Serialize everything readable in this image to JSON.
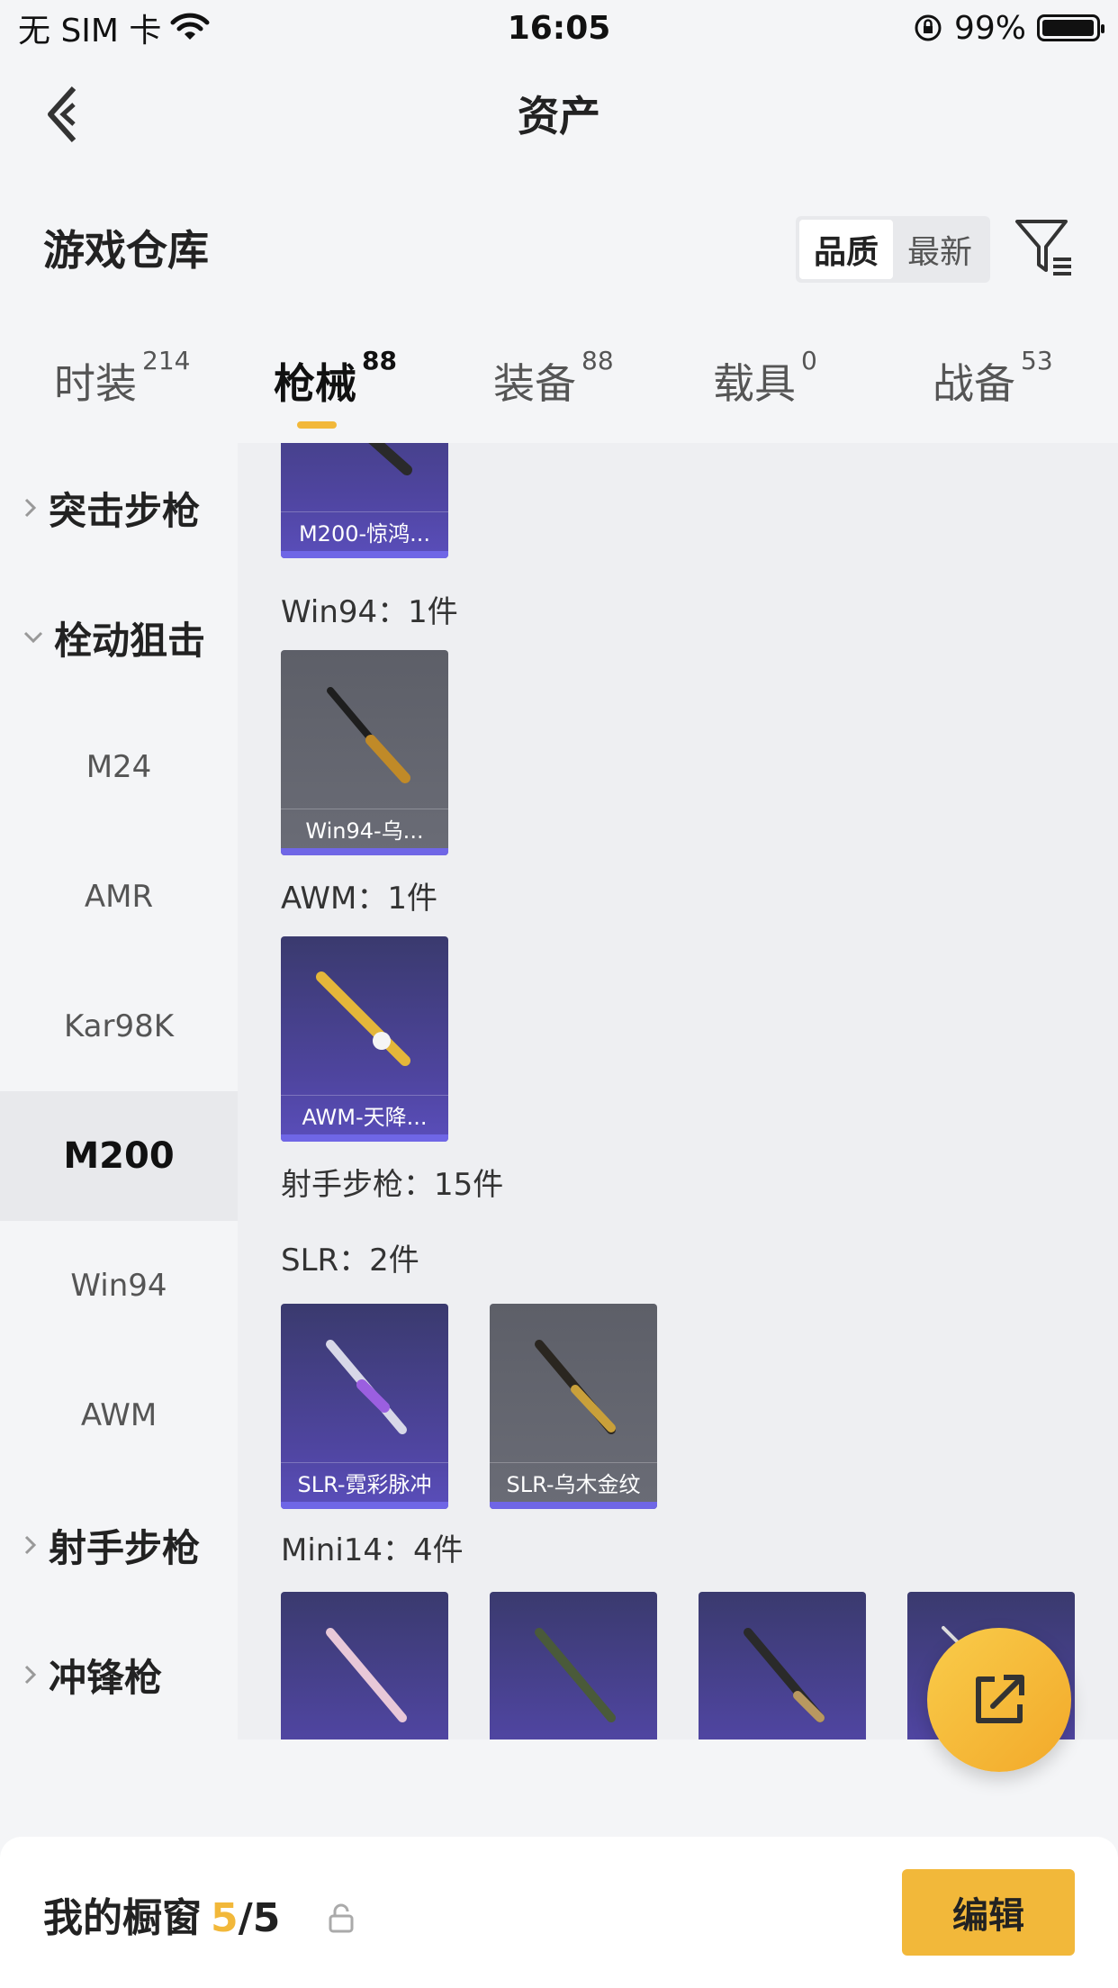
{
  "status_bar": {
    "carrier": "无 SIM 卡",
    "time": "16:05",
    "battery": "99%",
    "battery_level": 0.99
  },
  "header": {
    "title": "资产",
    "back_icon": "chevron-left-icon"
  },
  "warehouse": {
    "title": "游戏仓库",
    "sort_options": [
      "品质",
      "最新"
    ],
    "selected_sort": "品质",
    "filter_icon": "filter-icon"
  },
  "tabs": [
    {
      "label": "时装",
      "count": "214",
      "active": false
    },
    {
      "label": "枪械",
      "count": "88",
      "active": true
    },
    {
      "label": "装备",
      "count": "88",
      "active": false
    },
    {
      "label": "载具",
      "count": "0",
      "active": false
    },
    {
      "label": "战备",
      "count": "53",
      "active": false
    }
  ],
  "sidebar": {
    "items": [
      {
        "label": "突击步枪",
        "type": "group",
        "expanded": false
      },
      {
        "label": "栓动狙击",
        "type": "group",
        "expanded": true
      },
      {
        "label": "M24",
        "type": "sub"
      },
      {
        "label": "AMR",
        "type": "sub"
      },
      {
        "label": "Kar98K",
        "type": "sub"
      },
      {
        "label": "M200",
        "type": "sub",
        "selected": true
      },
      {
        "label": "Win94",
        "type": "sub"
      },
      {
        "label": "AWM",
        "type": "sub"
      },
      {
        "label": "射手步枪",
        "type": "group",
        "expanded": false
      },
      {
        "label": "冲锋枪",
        "type": "group",
        "expanded": false
      }
    ]
  },
  "content": {
    "groups": [
      {
        "label": "",
        "cards": [
          {
            "name": "M200-惊鸿...",
            "style": "purple"
          }
        ]
      },
      {
        "label": "Win94：1件",
        "cards": [
          {
            "name": "Win94-乌...",
            "style": "gray"
          }
        ]
      },
      {
        "label": "AWM：1件",
        "cards": [
          {
            "name": "AWM-天降...",
            "style": "purple"
          }
        ]
      },
      {
        "label": "射手步枪：15件",
        "cards": []
      },
      {
        "label": "SLR：2件",
        "cards": [
          {
            "name": "SLR-霓彩脉冲",
            "style": "purple"
          },
          {
            "name": "SLR-乌木金纹",
            "style": "gray"
          }
        ]
      },
      {
        "label": "Mini14：4件",
        "cards": [
          {
            "name": "",
            "style": "purple"
          },
          {
            "name": "",
            "style": "purple"
          },
          {
            "name": "",
            "style": "purple"
          },
          {
            "name": "",
            "style": "purple"
          }
        ]
      }
    ]
  },
  "fab": {
    "icon": "share-external-icon"
  },
  "bottom_bar": {
    "title": "我的橱窗",
    "count_current": "5",
    "count_separator": "/",
    "count_total": "5",
    "lock_icon": "lock-icon",
    "edit_label": "编辑"
  },
  "colors": {
    "accent": "#f2b83a",
    "card_purple": "#4f45a0",
    "card_gray": "#63656f",
    "rarity_bar": "#6f66e6"
  }
}
